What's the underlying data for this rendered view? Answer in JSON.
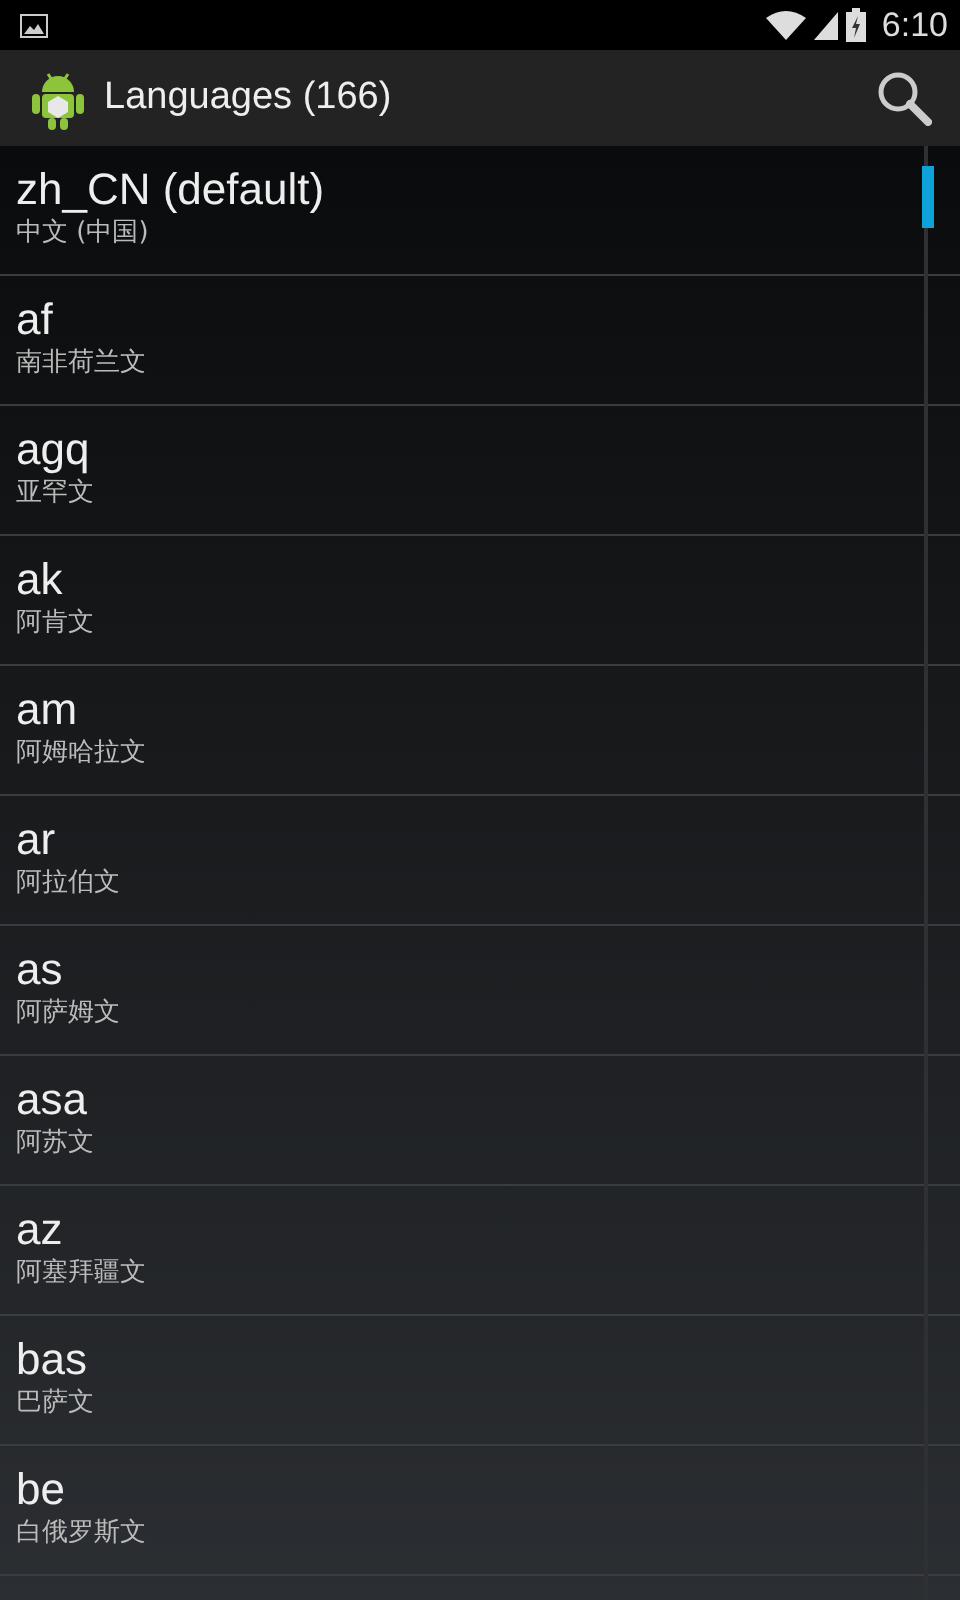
{
  "status_bar": {
    "time": "6:10"
  },
  "app_bar": {
    "title": "Languages (166)"
  },
  "languages": [
    {
      "code": "zh_CN (default)",
      "name": "中文 (中国)"
    },
    {
      "code": "af",
      "name": "南非荷兰文"
    },
    {
      "code": "agq",
      "name": "亚罕文"
    },
    {
      "code": "ak",
      "name": "阿肯文"
    },
    {
      "code": "am",
      "name": "阿姆哈拉文"
    },
    {
      "code": "ar",
      "name": "阿拉伯文"
    },
    {
      "code": "as",
      "name": "阿萨姆文"
    },
    {
      "code": "asa",
      "name": "阿苏文"
    },
    {
      "code": "az",
      "name": "阿塞拜疆文"
    },
    {
      "code": "bas",
      "name": "巴萨文"
    },
    {
      "code": "be",
      "name": "白俄罗斯文"
    }
  ]
}
